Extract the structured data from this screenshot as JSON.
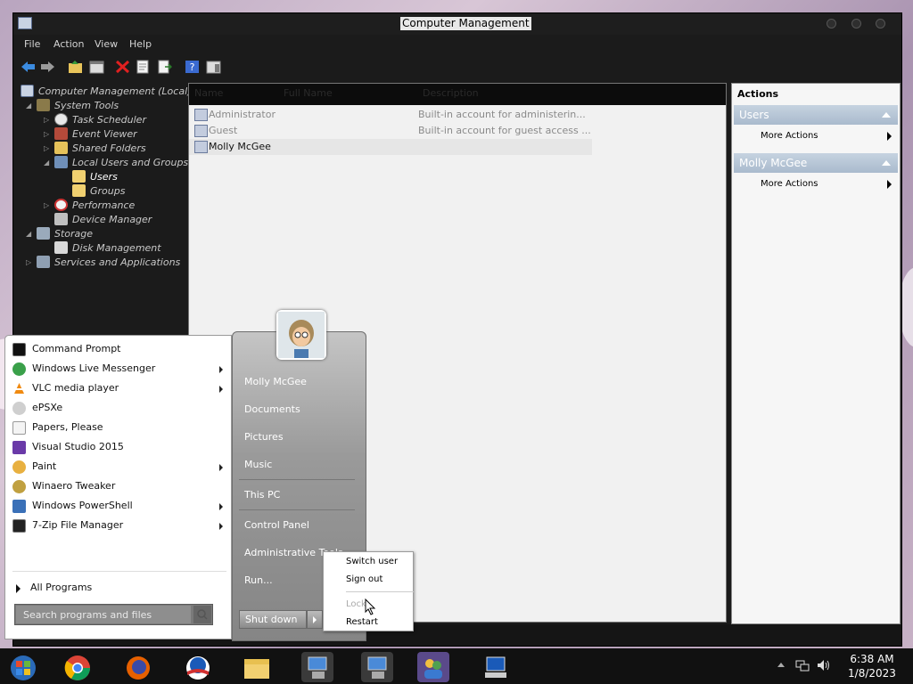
{
  "window": {
    "title": "Computer Management",
    "menu": [
      "File",
      "Action",
      "View",
      "Help"
    ]
  },
  "tree": {
    "items": [
      {
        "label": "Computer Management (Local)"
      },
      {
        "label": "System Tools"
      },
      {
        "label": "Task Scheduler"
      },
      {
        "label": "Event Viewer"
      },
      {
        "label": "Shared Folders"
      },
      {
        "label": "Local Users and Groups"
      },
      {
        "label": "Users"
      },
      {
        "label": "Groups"
      },
      {
        "label": "Performance"
      },
      {
        "label": "Device Manager"
      },
      {
        "label": "Storage"
      },
      {
        "label": "Disk Management"
      },
      {
        "label": "Services and Applications"
      }
    ]
  },
  "list": {
    "columns": [
      "Name",
      "Full Name",
      "Description"
    ],
    "rows": [
      {
        "name": "Administrator",
        "description": "Built-in account for administerin..."
      },
      {
        "name": "Guest",
        "description": "Built-in account for guest access ..."
      },
      {
        "name": "Molly McGee",
        "description": ""
      }
    ]
  },
  "actions": {
    "title": "Actions",
    "sections": [
      {
        "header": "Users",
        "item": "More Actions"
      },
      {
        "header": "Molly McGee",
        "item": "More Actions"
      }
    ]
  },
  "start_menu": {
    "programs": [
      {
        "label": "Command Prompt",
        "icon": "cmd-icon"
      },
      {
        "label": "Windows Live Messenger",
        "icon": "messenger-icon"
      },
      {
        "label": "VLC media player",
        "icon": "vlc-icon"
      },
      {
        "label": "ePSXe",
        "icon": "gamepad-icon"
      },
      {
        "label": "Papers, Please",
        "icon": "document-icon"
      },
      {
        "label": "Visual Studio 2015",
        "icon": "visual-studio-icon"
      },
      {
        "label": "Paint",
        "icon": "paint-icon"
      },
      {
        "label": "Winaero Tweaker",
        "icon": "tweaker-icon"
      },
      {
        "label": "Windows PowerShell",
        "icon": "powershell-icon"
      },
      {
        "label": "7-Zip File Manager",
        "icon": "7zip-icon"
      }
    ],
    "all_programs": "All Programs",
    "search_placeholder": "Search programs and files",
    "right": {
      "user": "Molly McGee",
      "documents": "Documents",
      "pictures": "Pictures",
      "music": "Music",
      "this_pc": "This PC",
      "control_panel": "Control Panel",
      "admin_tools": "Administrative Tools",
      "run": "Run..."
    },
    "shutdown": "Shut down"
  },
  "power_menu": {
    "items": [
      "Switch user",
      "Sign out",
      "Lock",
      "Restart"
    ]
  },
  "taskbar": {
    "time": "6:38 AM",
    "date": "1/8/2023"
  }
}
